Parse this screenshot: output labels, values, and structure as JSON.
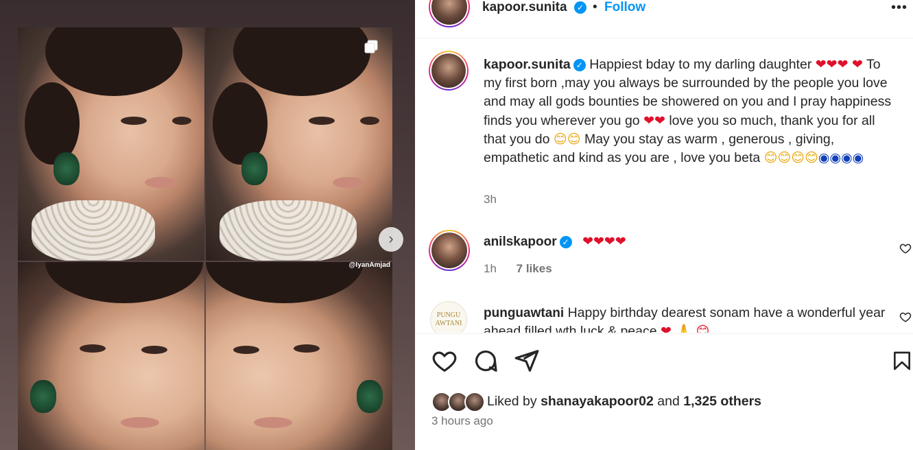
{
  "post": {
    "watermark": "@IyanAmjad"
  },
  "header": {
    "username": "kapoor.sunita",
    "verified_mark": "✓",
    "separator": "•",
    "follow_label": "Follow",
    "more_label": "•••"
  },
  "caption": {
    "username": "kapoor.sunita",
    "text_1": "Happiest bday to my darling daughter",
    "emoji_hearts_1": "❤❤❤",
    "emoji_hearts_2": "❤",
    "text_2": "To my first born ,may you always be surrounded by the people you love and may all gods bounties be showered on you and I pray happiness finds you wherever you go",
    "emoji_hearts_3": "❤❤",
    "text_3": "love you so much, thank you for all that you do",
    "emoji_faces": "😊😊",
    "text_4": "May you stay as warm , generous , giving, empathetic and kind as you are , love you beta",
    "emoji_hugs": "😊😊😊😊",
    "emoji_eyes": "◉◉◉◉",
    "time": "3h"
  },
  "comments": [
    {
      "username": "anilskapoor",
      "text": "❤❤❤❤",
      "time": "1h",
      "likes": "7 likes"
    },
    {
      "username": "punguawtani",
      "avatar_text": "PUNGU AWTANI",
      "text": "Happy birthday dearest sonam have a wonderful year ahead filled wth luck & peace",
      "emoji": "❤ 🙏 😊"
    }
  ],
  "likes": {
    "prefix": "Liked by",
    "user": "shanayakapoor02",
    "middle": "and",
    "others": "1,325 others"
  },
  "post_time": "3 hours ago",
  "colors": {
    "accent": "#0095f6",
    "heart": "#e0102b",
    "muted": "#737373",
    "text": "#262626"
  },
  "icons": [
    "multiple-images-icon",
    "chevron-right-icon",
    "verified-icon",
    "more-icon",
    "heart-icon",
    "comment-icon",
    "share-icon",
    "bookmark-icon"
  ]
}
